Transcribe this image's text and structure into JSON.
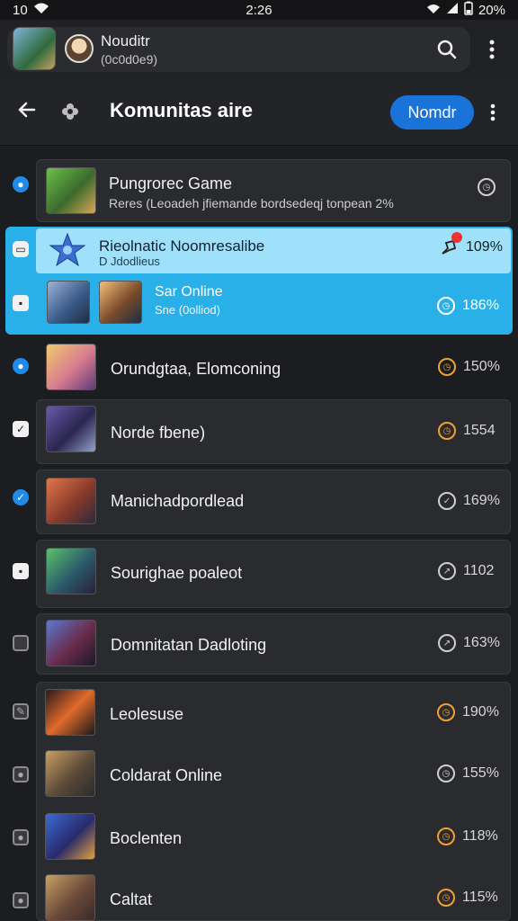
{
  "status": {
    "time_left": "10",
    "time_center": "2:26",
    "battery": "20%"
  },
  "account": {
    "name": "Nouditr",
    "sub": "(0c0d0e9)"
  },
  "header": {
    "title": "Komunitas aire",
    "primary_button": "Nomdr"
  },
  "selected": {
    "title": "Rieolnatic Noomresalibe",
    "sub": "D Jdodlieus",
    "value": "109%",
    "second_title": "Sar Online",
    "second_sub": "Sne (0olliod)",
    "second_value": "186%"
  },
  "items": [
    {
      "title": "Pungrorec Game",
      "sub": "Reres  (Leoadeh jfiemande bordsedeqj tonpean 2%",
      "value": "",
      "ring": "gray"
    },
    {
      "title": "Orundgtaa, Elomconing",
      "value": "150%",
      "ring": "orange"
    },
    {
      "title": "Norde fbene)",
      "value": "1554",
      "ring": "orange"
    },
    {
      "title": "Manichadpordlead",
      "value": "169%",
      "ring": "gray"
    },
    {
      "title": "Sourighae poaleot",
      "value": "1102",
      "ring": "gray"
    },
    {
      "title": "Domnitatan Dadloting",
      "value": "163%",
      "ring": "gray"
    },
    {
      "title": "Leolesuse",
      "value": "190%",
      "ring": "orange"
    },
    {
      "title": "Coldarat Online",
      "value": "155%",
      "ring": "gray"
    },
    {
      "title": "Boclenten",
      "value": "118%",
      "ring": "orange"
    },
    {
      "title": "Caltat",
      "value": "115%",
      "ring": "orange"
    }
  ],
  "icons": {
    "back": "arrow-left-icon",
    "search": "search-icon",
    "more": "more-vertical-icon",
    "pin": "pin-icon"
  },
  "colors": {
    "accent": "#1a73d9",
    "selection": "#2ab0e8",
    "warning": "#f0a033"
  }
}
